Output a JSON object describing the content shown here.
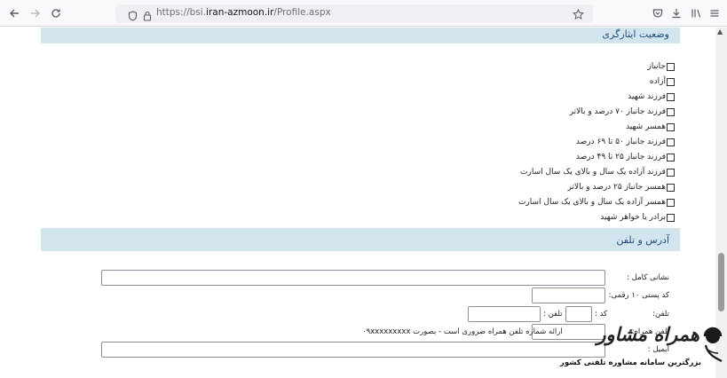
{
  "browser": {
    "url_prefix": "https://bsi.",
    "url_host": "iran-azmoon.ir",
    "url_path": "/Profile.aspx",
    "back_icon": "back-arrow-icon",
    "forward_icon": "forward-arrow-icon",
    "reload_icon": "reload-icon"
  },
  "sacrifice_section": {
    "title": "وضعیت ایثارگری",
    "options": [
      "جانباز",
      "آزاده",
      "فرزند شهید",
      "فرزند جانباز ۷۰ درصد و بالاتر",
      "همسر شهید",
      "فرزند جانباز ۵۰ تا ۶۹ درصد",
      "فرزند جانباز ۲۵ تا ۴۹ درصد",
      "فرزند آزاده یک سال و بالای یک سال اسارت",
      "همسر جانباز ۲۵ درصد و بالاتر",
      "همسر آزاده یک سال و بالای یک سال اسارت",
      "برادر یا خواهر شهید"
    ]
  },
  "address_section": {
    "title": "آدرس و تلفن",
    "full_address_label": "نشانی کامل :",
    "postal_code_label": "کد پستی ۱۰ رقمی:",
    "phone_label": "تلفن:",
    "phone_code_label": "کد :",
    "phone_number_label": "تلفن :",
    "mobile_label": "تلفن همراه:",
    "mobile_note": "ارائه شماره تلفن همراه ضروری است - بصورت ۰۹xxxxxxxxx",
    "email_label": "ایمیل :"
  },
  "watermark": {
    "title": "همراه مشاور",
    "subtitle": "بزرگترین سامانه مشاوره تلفنی کشور"
  }
}
